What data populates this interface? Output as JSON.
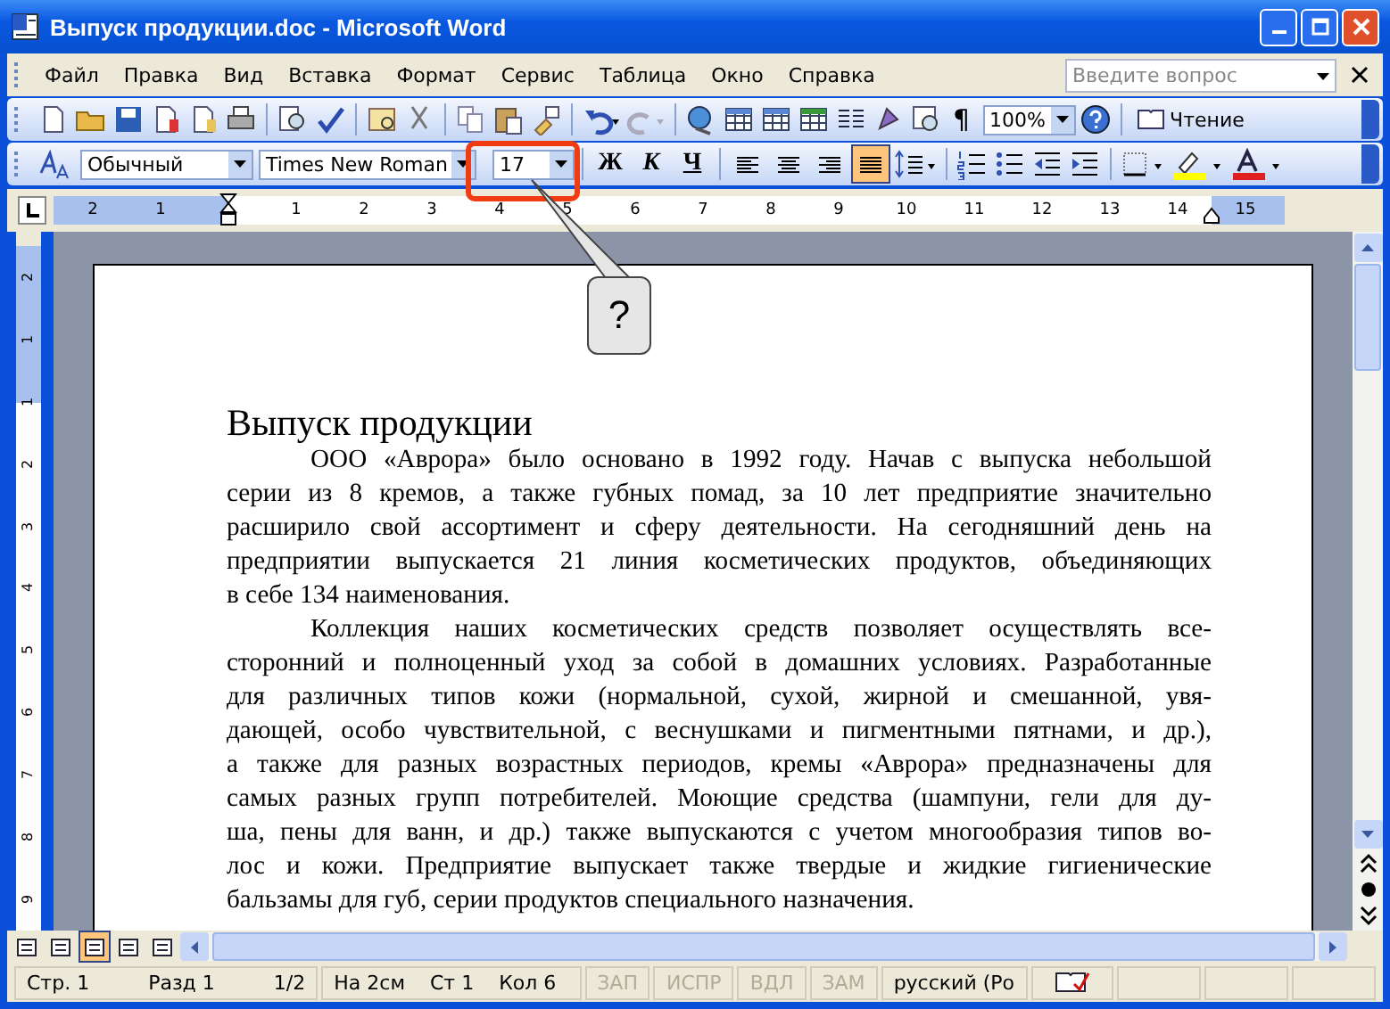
{
  "window": {
    "title": "Выпуск продукции.doc - Microsoft Word"
  },
  "menu": [
    {
      "label": "Файл"
    },
    {
      "label": "Правка"
    },
    {
      "label": "Вид"
    },
    {
      "label": "Вставка"
    },
    {
      "label": "Формат"
    },
    {
      "label": "Сервис"
    },
    {
      "label": "Таблица"
    },
    {
      "label": "Окно"
    },
    {
      "label": "Справка"
    }
  ],
  "help_search": {
    "placeholder": "Введите вопрос"
  },
  "standard_toolbar": {
    "pilcrow": "¶",
    "zoom": "100%",
    "reading_button": "Чтение"
  },
  "formatting_toolbar": {
    "style": "Обычный",
    "font": "Times New Roman",
    "size": "17",
    "bold": "Ж",
    "italic": "К",
    "underline": "Ч",
    "alignments": [
      {
        "selected": false
      },
      {
        "selected": false
      },
      {
        "selected": false
      },
      {
        "selected": true
      }
    ]
  },
  "callout": {
    "text": "?"
  },
  "ruler": {
    "labels": [
      "2",
      "1",
      "1",
      "2",
      "3",
      "4",
      "5",
      "6",
      "7",
      "8",
      "9",
      "10",
      "11",
      "12",
      "13",
      "14",
      "15"
    ]
  },
  "vertical_ruler": {
    "labels": [
      "2",
      "1",
      "1",
      "2",
      "3",
      "4",
      "5",
      "6",
      "7",
      "8",
      "9"
    ]
  },
  "document": {
    "title": "Выпуск продукции",
    "paragraphs": [
      [
        "ООО «Аврора» было основано в 1992 году. Начав с выпуска небольшой",
        "серии из 8 кремов, а также губных помад, за 10 лет предприятие значительно",
        "расширило свой ассортимент и сферу деятельности. На сегодняшний день на",
        "предприятии выпускается 21 линия косметических продуктов, объединяющих",
        "в себе 134 наименования."
      ],
      [
        "Коллекция наших косметических средств позволяет осуществлять все-",
        "сторонний и полноценный уход за собой в домашних условиях. Разработанные",
        "для различных типов кожи (нормальной, сухой, жирной и смешанной, увя-",
        "дающей, особо чувствительной, с веснушками и пигментными пятнами, и др.),",
        "а также для разных возрастных периодов, кремы «Аврора» предназначены для",
        "самых разных групп потребителей. Моющие средства (шампуни, гели для ду-",
        "ша, пены для ванн, и др.) также выпускаются с учетом многообразия типов во-",
        "лос и кожи. Предприятие выпускает также твердые и жидкие гигиенические",
        "бальзамы для губ, серии продуктов специального назначения."
      ]
    ]
  },
  "view_buttons": [
    {
      "selected": false
    },
    {
      "selected": false
    },
    {
      "selected": true
    },
    {
      "selected": false
    },
    {
      "selected": false
    }
  ],
  "status_bar": {
    "panels": [
      {
        "items": [
          {
            "text": "Стр. 1",
            "disabled": false
          },
          {
            "text": "Разд 1",
            "disabled": false
          },
          {
            "text": "1/2",
            "disabled": false
          }
        ]
      },
      {
        "items": [
          {
            "text": "На 2см",
            "disabled": false
          },
          {
            "text": "Ст 1",
            "disabled": false
          },
          {
            "text": "Кол 6",
            "disabled": false
          }
        ]
      },
      {
        "items": [
          {
            "text": "ЗАП",
            "disabled": true
          }
        ]
      },
      {
        "items": [
          {
            "text": "ИСПР",
            "disabled": true
          }
        ]
      },
      {
        "items": [
          {
            "text": "ВДЛ",
            "disabled": true
          }
        ]
      },
      {
        "items": [
          {
            "text": "ЗАМ",
            "disabled": true
          }
        ]
      },
      {
        "items": [
          {
            "text": "русский (Ро",
            "disabled": false
          }
        ]
      }
    ]
  }
}
